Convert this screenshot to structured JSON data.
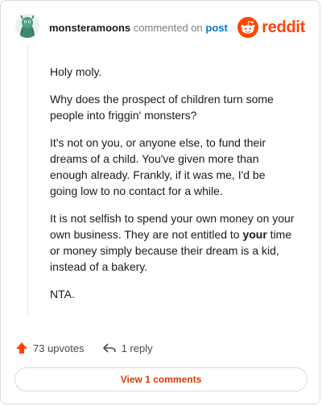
{
  "comment": {
    "username": "monsteramoons",
    "commented_text": "commented on",
    "post_link": "post",
    "brand": "reddit",
    "paragraphs": {
      "p1": "Holy moly.",
      "p2": "Why does the prospect of children turn some people into friggin' monsters?",
      "p3": "It's not on you, or anyone else, to fund their dreams of a child. You've given more than enough already. Frankly, if it was me, I'd be going low to no contact for a while.",
      "p4_before": "It is not selfish to spend your own money on your own business. They are not entitled to ",
      "p4_bold": "your",
      "p4_after": " time or money simply because their dream is a kid, instead of a bakery.",
      "p5": "NTA."
    }
  },
  "actions": {
    "upvotes": "73 upvotes",
    "replies": "1 reply"
  },
  "view_button": "View 1 comments",
  "colors": {
    "brand_orange": "#ff4500",
    "link_blue": "#0079d3",
    "button_text": "#d93a00"
  },
  "icons": {
    "upvote": "upvote-arrow-icon",
    "reply": "reply-arrow-icon",
    "logo": "reddit-snoo-icon"
  }
}
